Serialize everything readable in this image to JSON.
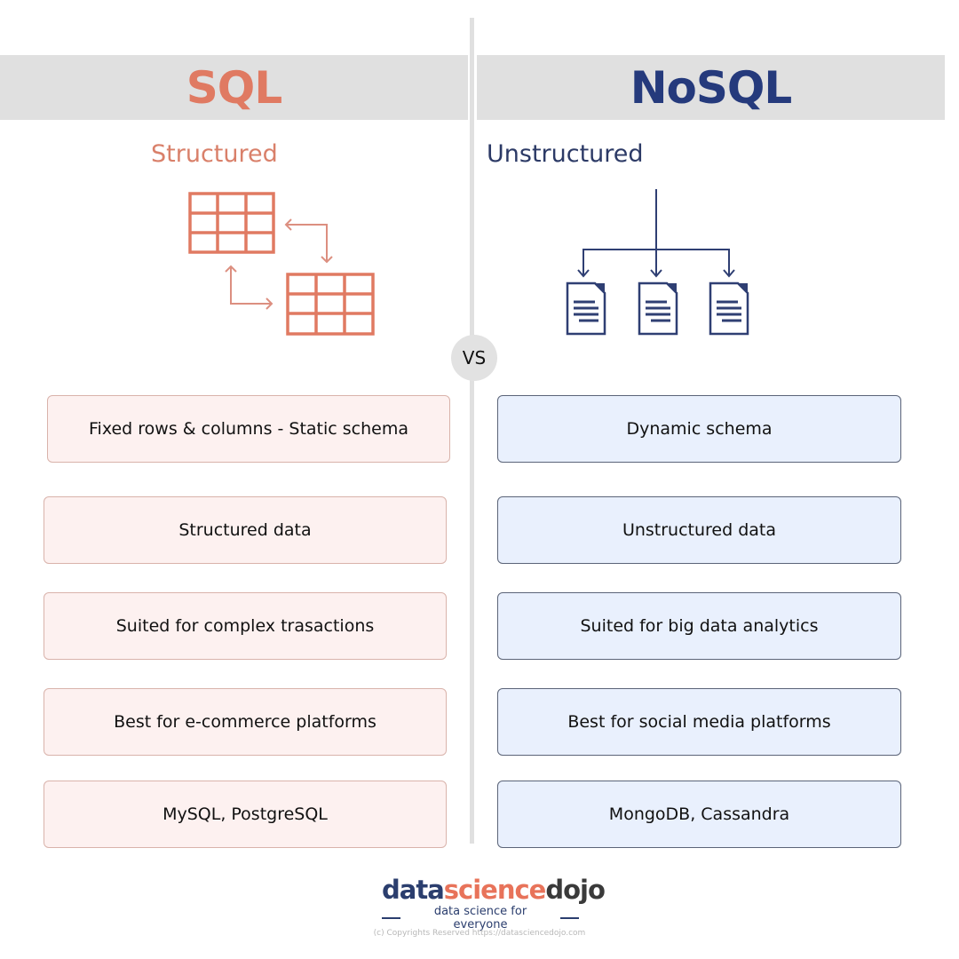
{
  "colors": {
    "sql_accent": "#e07a62",
    "nosql_accent": "#253a7c",
    "header_band": "#e0e0e0",
    "sql_card_bg": "#fdf1f0",
    "nosql_card_bg": "#e9f0fd"
  },
  "sql": {
    "title": "SQL",
    "subtitle": "Structured",
    "icon": "relational-tables-icon",
    "features": [
      "Fixed rows & columns - Static schema",
      "Structured data",
      "Suited for complex trasactions",
      "Best for e-commerce platforms",
      "MySQL, PostgreSQL"
    ]
  },
  "nosql": {
    "title": "NoSQL",
    "subtitle": "Unstructured",
    "icon": "document-tree-icon",
    "features": [
      "Dynamic schema",
      "Unstructured data",
      "Suited for big data analytics",
      "Best for social media platforms",
      "MongoDB, Cassandra"
    ]
  },
  "vs_label": "VS",
  "footer": {
    "logo_part1": "data",
    "logo_part2": "science",
    "logo_part3": "dojo",
    "tagline": "data science for everyone",
    "copyright": "(c) Copyrights Reserved  https://datasciencedojo.com"
  }
}
